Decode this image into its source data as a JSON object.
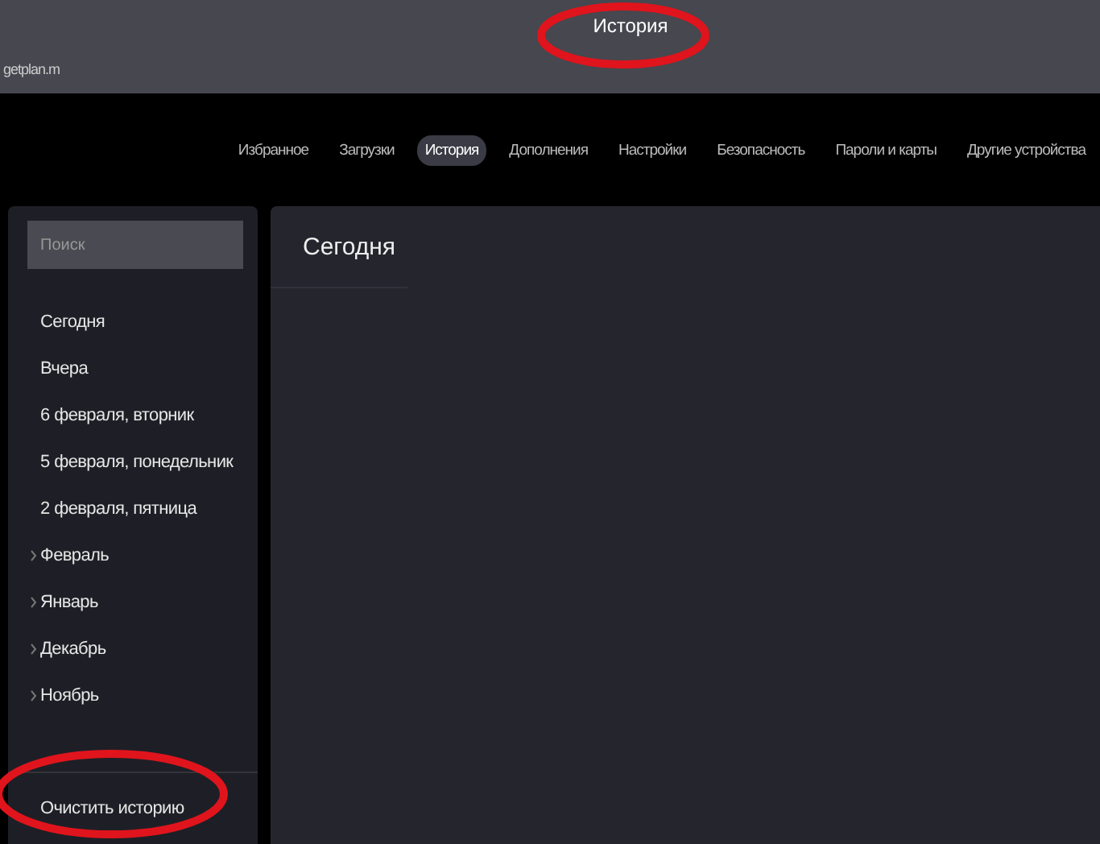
{
  "window": {
    "title": "История",
    "tab_title": "getplan.m"
  },
  "nav": [
    {
      "label": "Избранное",
      "selected": false
    },
    {
      "label": "Загрузки",
      "selected": false
    },
    {
      "label": "История",
      "selected": true
    },
    {
      "label": "Дополнения",
      "selected": false
    },
    {
      "label": "Настройки",
      "selected": false
    },
    {
      "label": "Безопасность",
      "selected": false
    },
    {
      "label": "Пароли и карты",
      "selected": false
    },
    {
      "label": "Другие устройства",
      "selected": false
    }
  ],
  "sidebar": {
    "search": {
      "placeholder": "Поиск"
    },
    "items": [
      {
        "kind": "day",
        "label": "Сегодня"
      },
      {
        "kind": "day",
        "label": "Вчера"
      },
      {
        "kind": "day",
        "label": "6 февраля, вторник"
      },
      {
        "kind": "day",
        "label": "5 февраля, понедельник"
      },
      {
        "kind": "day",
        "label": "2 февраля, пятница"
      },
      {
        "kind": "month",
        "label": "Февраль"
      },
      {
        "kind": "month",
        "label": "Январь"
      },
      {
        "kind": "month",
        "label": "Декабрь"
      },
      {
        "kind": "month",
        "label": "Ноябрь"
      }
    ],
    "clear_button": "Очистить историю"
  },
  "main": {
    "heading": "Сегодня"
  }
}
